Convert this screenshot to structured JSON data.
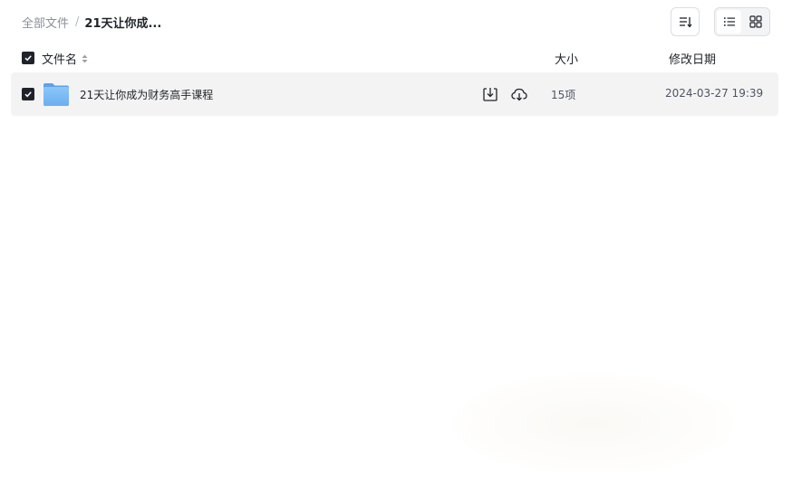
{
  "breadcrumb": {
    "root": "全部文件",
    "separator": "/",
    "current": "21天让你成..."
  },
  "toolbar": {
    "sort_icon": "sort-icon",
    "list_view_icon": "list-view-icon",
    "grid_view_icon": "grid-view-icon",
    "active_view": "list"
  },
  "columns": {
    "name": "文件名",
    "size": "大小",
    "modified": "修改日期"
  },
  "files": [
    {
      "name": "21天让你成为财务高手课程",
      "type_icon": "folder-icon",
      "size": "15项",
      "modified": "2024-03-27 19:39",
      "selected": true,
      "actions": [
        "download-icon",
        "save-to-cloud-icon"
      ]
    }
  ],
  "select_all": true,
  "colors": {
    "text": "#1f2329",
    "muted": "#8a8f99",
    "row_hover": "#f3f3f4",
    "checkbox": "#1f2329",
    "folder": "#7ab8f5"
  }
}
